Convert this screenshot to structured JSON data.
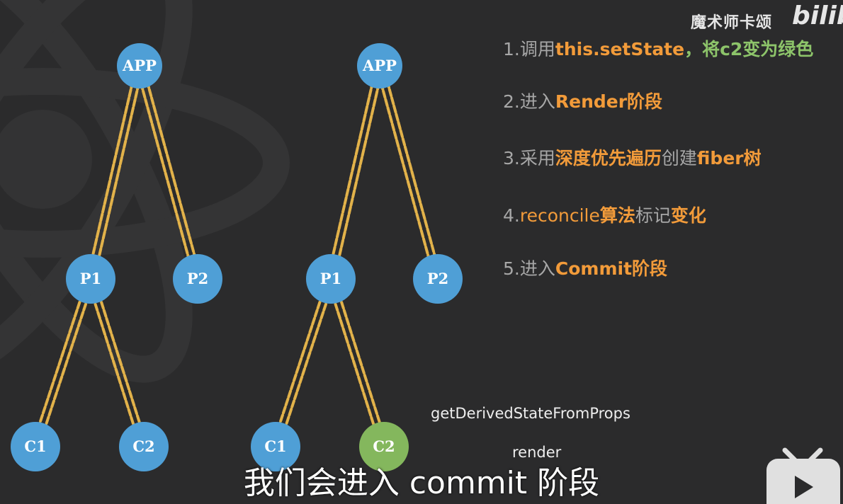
{
  "watermark": {
    "author": "魔术师卡颂",
    "logo": "bilib"
  },
  "steps": [
    {
      "num": "1.",
      "parts": [
        {
          "t": "调用",
          "s": "n"
        },
        {
          "t": "this.setState",
          "s": "o"
        },
        {
          "t": "，将c2变为绿色",
          "s": "g"
        }
      ]
    },
    {
      "num": "2.",
      "parts": [
        {
          "t": "进入",
          "s": "n"
        },
        {
          "t": "Render阶段",
          "s": "o"
        }
      ]
    },
    {
      "num": "3.",
      "parts": [
        {
          "t": "采用",
          "s": "n"
        },
        {
          "t": "深度优先遍历",
          "s": "o"
        },
        {
          "t": "创建",
          "s": "n"
        },
        {
          "t": "fiber树",
          "s": "o"
        }
      ]
    },
    {
      "num": "4.",
      "parts": [
        {
          "t": "reconcile",
          "s": "oa"
        },
        {
          "t": "算法",
          "s": "o"
        },
        {
          "t": "标记",
          "s": "n"
        },
        {
          "t": "变化",
          "s": "o"
        }
      ]
    },
    {
      "num": "5.",
      "parts": [
        {
          "t": "进入",
          "s": "n"
        },
        {
          "t": "Commit阶段",
          "s": "o"
        }
      ]
    }
  ],
  "trees": [
    {
      "nodes": [
        {
          "id": "APP",
          "label": "APP"
        },
        {
          "id": "P1",
          "label": "P1"
        },
        {
          "id": "P2",
          "label": "P2"
        },
        {
          "id": "C1",
          "label": "C1"
        },
        {
          "id": "C2",
          "label": "C2"
        }
      ]
    },
    {
      "nodes": [
        {
          "id": "APP",
          "label": "APP"
        },
        {
          "id": "P1",
          "label": "P1"
        },
        {
          "id": "P2",
          "label": "P2"
        },
        {
          "id": "C1",
          "label": "C1"
        },
        {
          "id": "C2",
          "label": "C2",
          "highlight": true
        }
      ]
    }
  ],
  "lifecycle": {
    "first": "getDerivedStateFromProps",
    "second": "render"
  },
  "subtitle": "我们会进入 commit 阶段",
  "colors": {
    "node": "#4f9fd6",
    "highlight": "#84b75d",
    "edge": "#e2b24a",
    "orange": "#f29b3a",
    "green": "#8dc46a"
  },
  "icons": {
    "tv": "bilibili-tv-icon"
  }
}
